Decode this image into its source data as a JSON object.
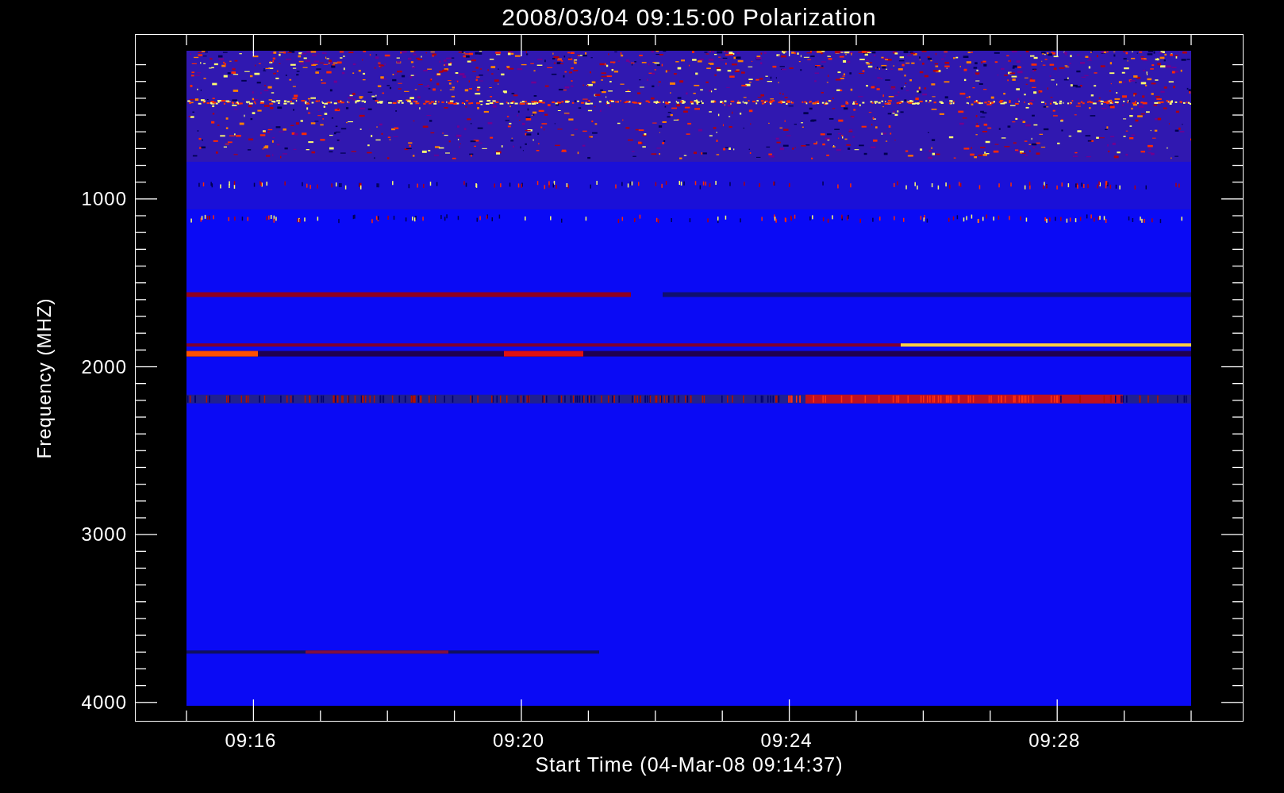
{
  "title": "2008/03/04 09:15:00 Polarization",
  "y_axis": {
    "label": "Frequency (MHZ)",
    "ticks": [
      "1000",
      "2000",
      "3000",
      "4000"
    ]
  },
  "x_axis": {
    "label": "Start Time (04-Mar-08 09:14:37)",
    "ticks": [
      "09:16",
      "09:20",
      "09:24",
      "09:28"
    ]
  }
}
